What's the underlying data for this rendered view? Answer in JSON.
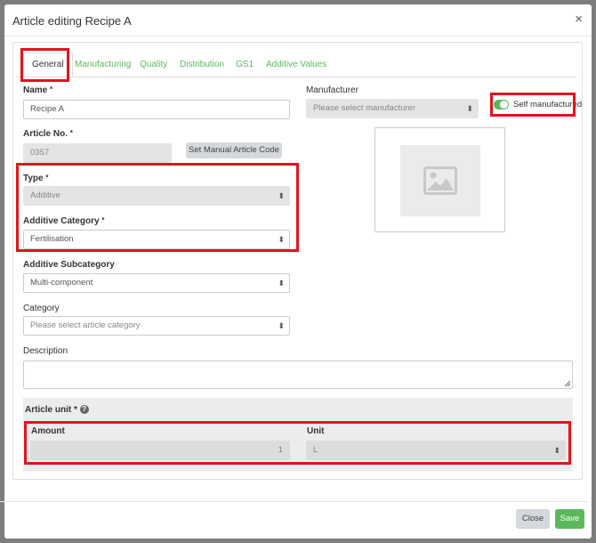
{
  "dialog": {
    "title": "Article editing Recipe A",
    "close_symbol": "×"
  },
  "tabs": [
    {
      "label": "General"
    },
    {
      "label": "Manufacturing"
    },
    {
      "label": "Quality"
    },
    {
      "label": "Distribution"
    },
    {
      "label": "GS1"
    },
    {
      "label": "Additive Values"
    }
  ],
  "form": {
    "required_mark": "*",
    "name": {
      "label": "Name",
      "value": "Recipe A"
    },
    "article_no": {
      "label": "Article No.",
      "value": "0357"
    },
    "manual_code_button": "Set Manual Article Code",
    "type": {
      "label": "Type",
      "value": "Additive"
    },
    "additive_category": {
      "label": "Additive Category",
      "value": "Fertilisation"
    },
    "additive_subcategory": {
      "label": "Additive Subcategory",
      "value": "Multi-component"
    },
    "category": {
      "label": "Category",
      "placeholder": "Please select article category"
    },
    "description": {
      "label": "Description",
      "value": ""
    },
    "manufacturer": {
      "label": "Manufacturer",
      "placeholder": "Please select manufacturer"
    },
    "self_manufactured": {
      "label": "Self manufactured",
      "checked": true
    },
    "article_unit": {
      "label": "Article unit *",
      "amount_label": "Amount",
      "amount_value": "1",
      "unit_label": "Unit",
      "unit_value": "L"
    }
  },
  "footer": {
    "close_label": "Close",
    "save_label": "Save"
  },
  "colors": {
    "accent": "#5cb85c",
    "highlight": "#e0141e",
    "disabled_bg": "#e4e4e4"
  }
}
